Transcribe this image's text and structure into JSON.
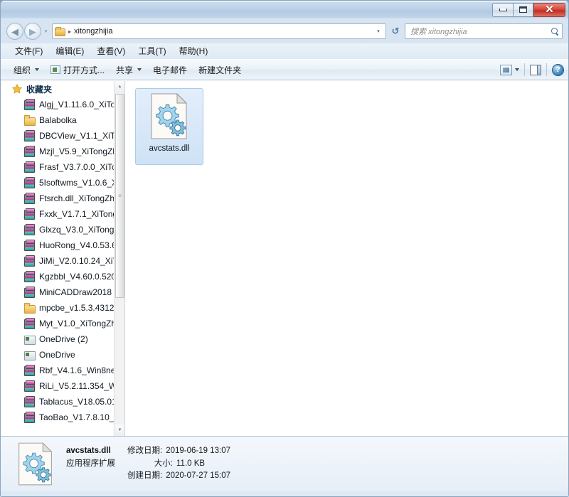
{
  "window": {
    "buttons": {
      "minimize": "–",
      "maximize": "□",
      "close": "✕"
    }
  },
  "addressbar": {
    "back_label": "◀",
    "forward_label": "▶",
    "dropdown_label": "▾",
    "folder_icon": "folder-icon",
    "separator": "▸",
    "path": "xitongzhijia",
    "caret": "▾",
    "refresh_label": "↺"
  },
  "search": {
    "placeholder": "搜索 xitongzhijia",
    "icon": "search-icon"
  },
  "menubar": {
    "items": [
      {
        "label": "文件(F)"
      },
      {
        "label": "编辑(E)"
      },
      {
        "label": "查看(V)"
      },
      {
        "label": "工具(T)"
      },
      {
        "label": "帮助(H)"
      }
    ]
  },
  "commandbar": {
    "organize": "组织",
    "open_with": "打开方式...",
    "share": "共享",
    "email": "电子邮件",
    "new_folder": "新建文件夹",
    "help_glyph": "?"
  },
  "navpane": {
    "header": "收藏夹",
    "items": [
      {
        "label": "Algj_V1.11.6.0_XiTo",
        "icon": "archive"
      },
      {
        "label": "Balabolka",
        "icon": "folder"
      },
      {
        "label": "DBCView_V1.1_XiTc",
        "icon": "archive"
      },
      {
        "label": "Mzjl_V5.9_XiTongZl",
        "icon": "archive"
      },
      {
        "label": "Frasf_V3.7.0.0_XiTo",
        "icon": "archive"
      },
      {
        "label": "5Isoftwms_V1.0.6_X",
        "icon": "archive"
      },
      {
        "label": "Ftsrch.dll_XiTongZh",
        "icon": "archive"
      },
      {
        "label": "Fxxk_V1.7.1_XiTong",
        "icon": "archive"
      },
      {
        "label": "Glxzq_V3.0_XiTong",
        "icon": "archive"
      },
      {
        "label": "HuoRong_V4.0.53.6",
        "icon": "archive"
      },
      {
        "label": "JiMi_V2.0.10.24_XiT",
        "icon": "archive"
      },
      {
        "label": "Kgzbbl_V4.60.0.520",
        "icon": "archive"
      },
      {
        "label": "MiniCADDraw2018",
        "icon": "archive"
      },
      {
        "label": "mpcbe_v1.5.3.4312",
        "icon": "folder"
      },
      {
        "label": "Myt_V1.0_XiTongZh",
        "icon": "archive"
      },
      {
        "label": "OneDrive (2)",
        "icon": "drive"
      },
      {
        "label": "OneDrive",
        "icon": "drive"
      },
      {
        "label": "Rbf_V4.1.6_Win8net",
        "icon": "archive"
      },
      {
        "label": "RiLi_V5.2.11.354_Wi",
        "icon": "archive"
      },
      {
        "label": "Tablacus_V18.05.01",
        "icon": "archive"
      },
      {
        "label": "TaoBao_V1.7.8.10_\\",
        "icon": "archive"
      }
    ],
    "scroll_up": "▲",
    "scroll_down": "▼",
    "thumb_grip": "≡"
  },
  "content": {
    "file": {
      "name": "avcstats.dll",
      "icon": "dll-gear-icon",
      "selected": true
    }
  },
  "details": {
    "file_name": "avcstats.dll",
    "file_type": "应用程序扩展",
    "modified_key": "修改日期:",
    "modified_value": "2019-06-19 13:07",
    "size_key": "大小:",
    "size_value": "11.0 KB",
    "created_key": "创建日期:",
    "created_value": "2020-07-27 15:07",
    "icon": "dll-gear-icon"
  },
  "colors": {
    "selection": "#cfe2f6",
    "selection_border": "#a8cbe8",
    "close_button": "#d9483c",
    "accent": "#4f8fc4"
  }
}
